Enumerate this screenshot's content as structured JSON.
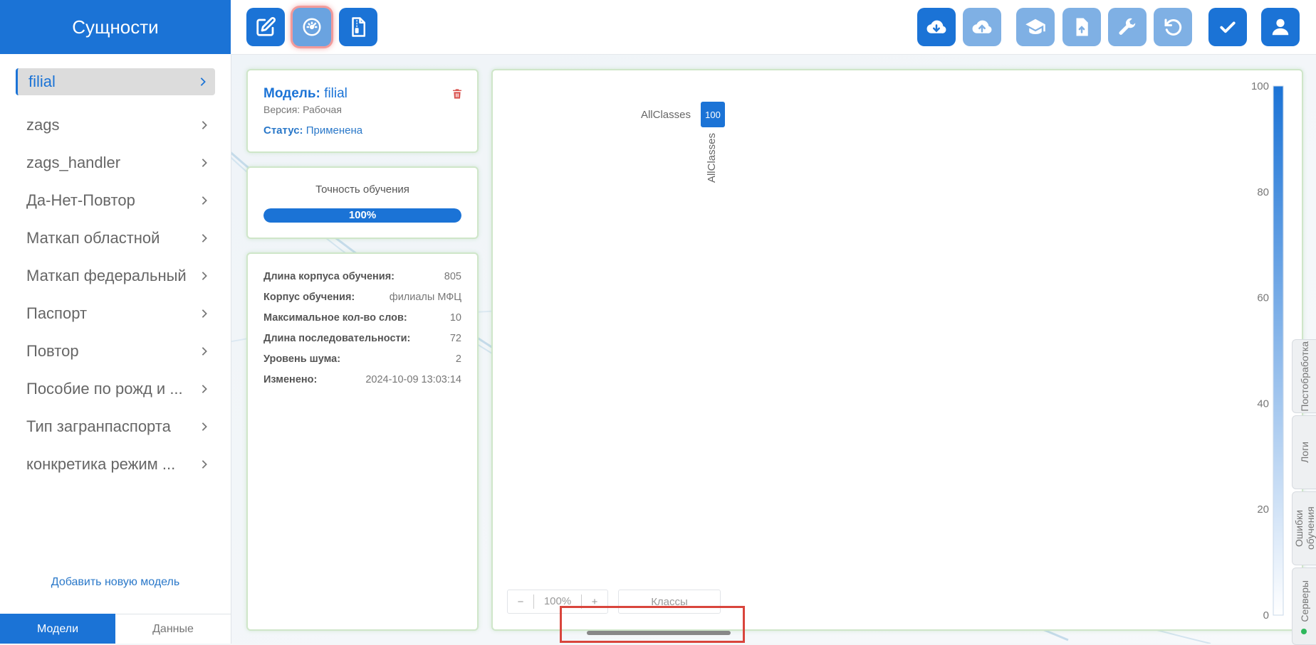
{
  "sidebar": {
    "title": "Сущности",
    "items": [
      {
        "label": "filial",
        "active": true
      },
      {
        "label": "zags"
      },
      {
        "label": "zags_handler"
      },
      {
        "label": "Да-Нет-Повтор"
      },
      {
        "label": "Маткап областной"
      },
      {
        "label": "Маткап федеральный"
      },
      {
        "label": "Паспорт"
      },
      {
        "label": "Повтор"
      },
      {
        "label": "Пособие по рожд и ..."
      },
      {
        "label": "Тип загранпаспорта"
      },
      {
        "label": "конкретика режим ..."
      }
    ],
    "add_model": "Добавить новую модель",
    "tabs": [
      {
        "label": "Модели",
        "active": true
      },
      {
        "label": "Данные"
      }
    ]
  },
  "toolbar": {
    "left_icons": [
      "edit-icon",
      "dashboard-icon",
      "file-archive-icon"
    ],
    "right_icons": [
      "cloud-download-icon",
      "cloud-upload-icon",
      "graduation-cap-icon",
      "file-upload-icon",
      "wrench-icon",
      "undo-icon",
      "check-icon",
      "user-icon"
    ]
  },
  "model": {
    "title_label": "Модель:",
    "title_value": "filial",
    "version": "Версия: Рабочая",
    "status_label": "Статус:",
    "status_value": "Применена"
  },
  "accuracy": {
    "title": "Точность обучения",
    "value_text": "100%",
    "value": 1.0
  },
  "stats": [
    {
      "key": "Длина корпуса обучения:",
      "value": "805"
    },
    {
      "key": "Корпус обучения:",
      "value": "филиалы МФЦ"
    },
    {
      "key": "Максимальное кол-во слов:",
      "value": "10"
    },
    {
      "key": "Длина последовательности:",
      "value": "72"
    },
    {
      "key": "Уровень шума:",
      "value": "2"
    },
    {
      "key": "Изменено:",
      "value": "2024-10-09 13:03:14"
    }
  ],
  "chart_data": {
    "type": "heatmap",
    "rows": [
      "AllClasses"
    ],
    "columns": [
      "AllClasses"
    ],
    "values": [
      [
        100
      ]
    ],
    "colorbar": {
      "min": 0,
      "max": 100,
      "ticks": [
        0,
        20,
        40,
        60,
        80,
        100
      ]
    },
    "colors": {
      "high": "#1b73d6",
      "low": "#ffffff"
    }
  },
  "chart_controls": {
    "zoom_minus": "−",
    "zoom_value": "100%",
    "zoom_plus": "+",
    "classes_button": "Классы"
  },
  "side_tabs": [
    "Постобработка",
    "Логи",
    "Ошибки обучения",
    "Серверы"
  ],
  "colors": {
    "accent": "#1b73d6",
    "status_online": "#2eb85c"
  }
}
